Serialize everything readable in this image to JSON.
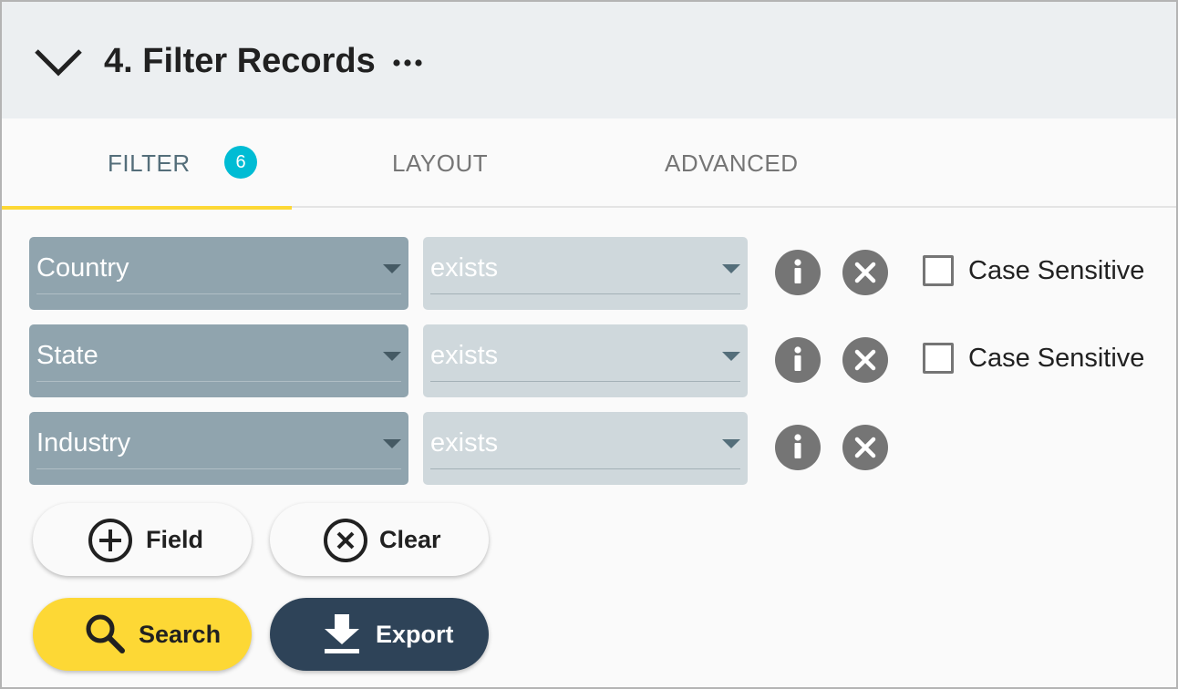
{
  "section": {
    "title": "4. Filter Records"
  },
  "tabs": [
    {
      "label": "FILTER",
      "badge": "6",
      "active": true
    },
    {
      "label": "LAYOUT",
      "active": false
    },
    {
      "label": "ADVANCED",
      "active": false
    }
  ],
  "filters": [
    {
      "field": "Country",
      "operator": "exists",
      "case_sensitive_label": "Case Sensitive",
      "case_sensitive": false
    },
    {
      "field": "State",
      "operator": "exists",
      "case_sensitive_label": "Case Sensitive",
      "case_sensitive": false
    },
    {
      "field": "Industry",
      "operator": "exists"
    }
  ],
  "actions": {
    "add_field_label": "Field",
    "clear_label": "Clear",
    "search_label": "Search",
    "export_label": "Export"
  },
  "icons": {
    "collapse": "chevron-down-icon",
    "more": "more-horizontal-icon",
    "info": "info-icon",
    "remove": "close-circle-icon",
    "add": "plus-circle-icon",
    "clear": "close-circle-outline-icon",
    "search": "search-icon",
    "export": "download-icon"
  },
  "colors": {
    "header_bg": "#eceff1",
    "tab_indicator": "#fdd835",
    "badge": "#00bcd4",
    "field_select": "#90a4ae",
    "operator_select": "#cfd8dc",
    "search_button": "#fdd835",
    "export_button": "#2e4358"
  }
}
